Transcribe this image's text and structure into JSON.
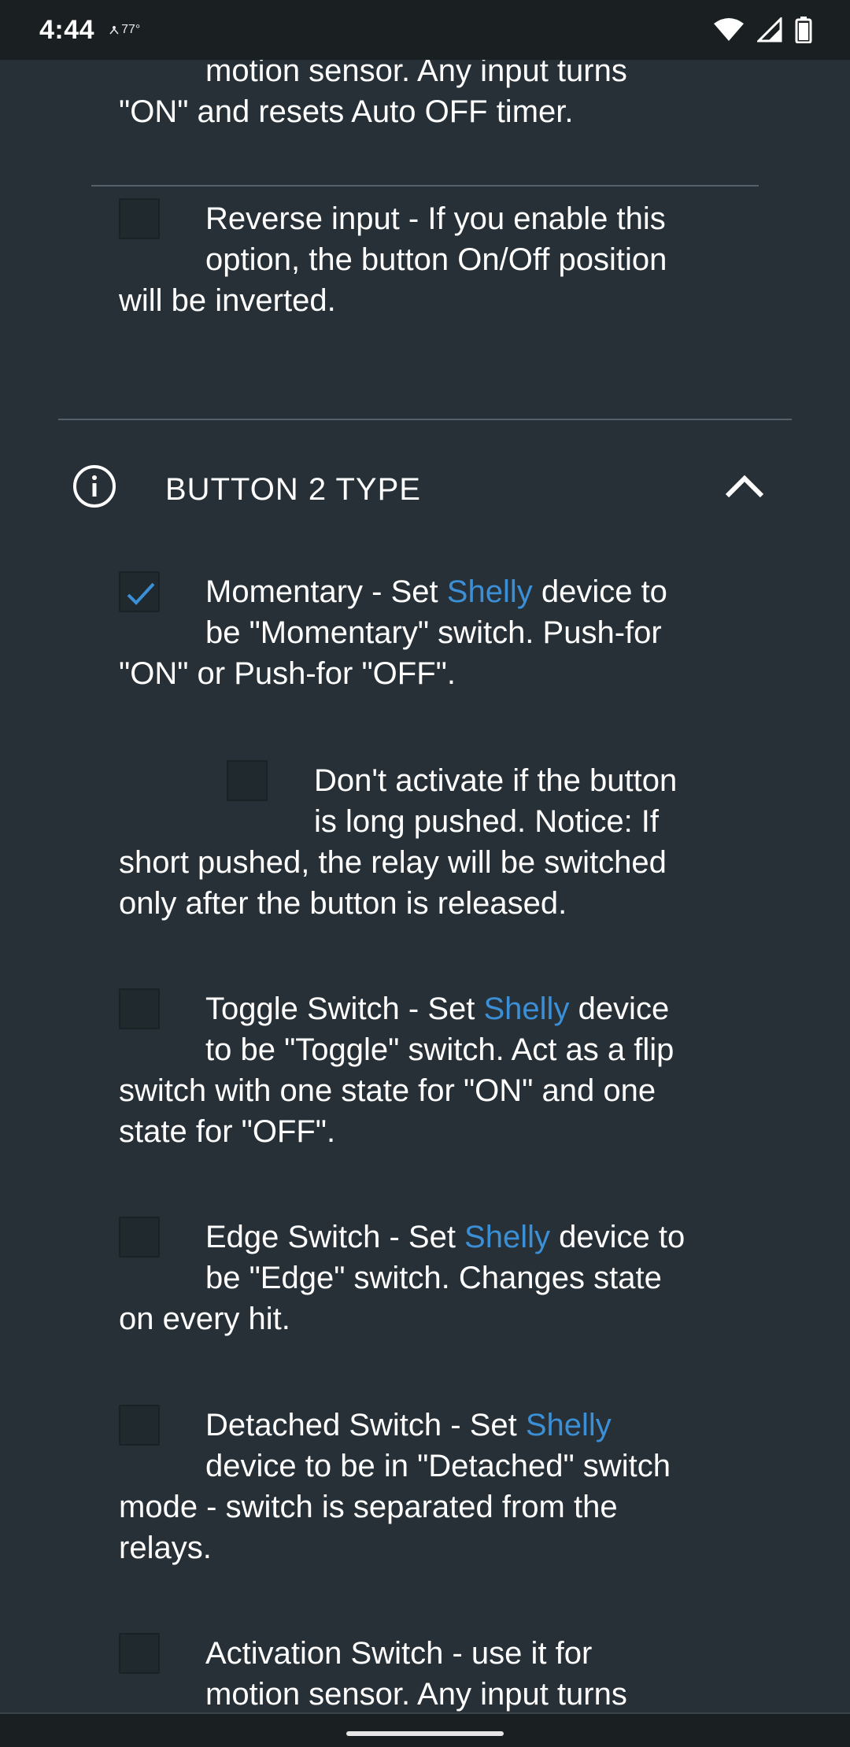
{
  "status_bar": {
    "time": "4:44",
    "temperature": "77°"
  },
  "top_fragment": {
    "line1": "motion sensor. Any input turns",
    "line2": "\"ON\" and resets Auto OFF timer."
  },
  "reverse_input": {
    "checked": false,
    "line1": "Reverse input - If you enable this",
    "line2": "option, the button On/Off position",
    "line3": "will be inverted."
  },
  "section": {
    "title": "BUTTON 2 TYPE",
    "expanded": true
  },
  "options": {
    "momentary": {
      "checked": true,
      "prefix": "Momentary - Set ",
      "link": "Shelly",
      "suffix": " device to",
      "line2": "be \"Momentary\" switch. Push-for",
      "line3": "\"ON\" or Push-for \"OFF\"."
    },
    "long_push": {
      "checked": false,
      "line1": "Don't activate if the button",
      "line2": "is long pushed. Notice: If",
      "line3": "short pushed, the relay will be switched",
      "line4": "only after the button is released."
    },
    "toggle": {
      "checked": false,
      "prefix": "Toggle Switch - Set ",
      "link": "Shelly",
      "suffix": " device",
      "line2": "to be \"Toggle\" switch. Act as a flip",
      "line3": "switch with one state for \"ON\" and one",
      "line4": "state for \"OFF\"."
    },
    "edge": {
      "checked": false,
      "prefix": "Edge Switch - Set ",
      "link": "Shelly",
      "suffix": " device to",
      "line2": "be \"Edge\" switch. Changes state",
      "line3": "on every hit."
    },
    "detached": {
      "checked": false,
      "prefix": "Detached Switch - Set ",
      "link": "Shelly",
      "line2": "device to be in \"Detached\" switch",
      "line3": "mode - switch is separated from the",
      "line4": "relays."
    },
    "activation": {
      "checked": false,
      "line1": "Activation Switch - use it for",
      "line2": "motion sensor. Any input turns"
    }
  },
  "colors": {
    "background": "#263036",
    "link": "#3b8fd6",
    "check": "#3b8fd6"
  }
}
